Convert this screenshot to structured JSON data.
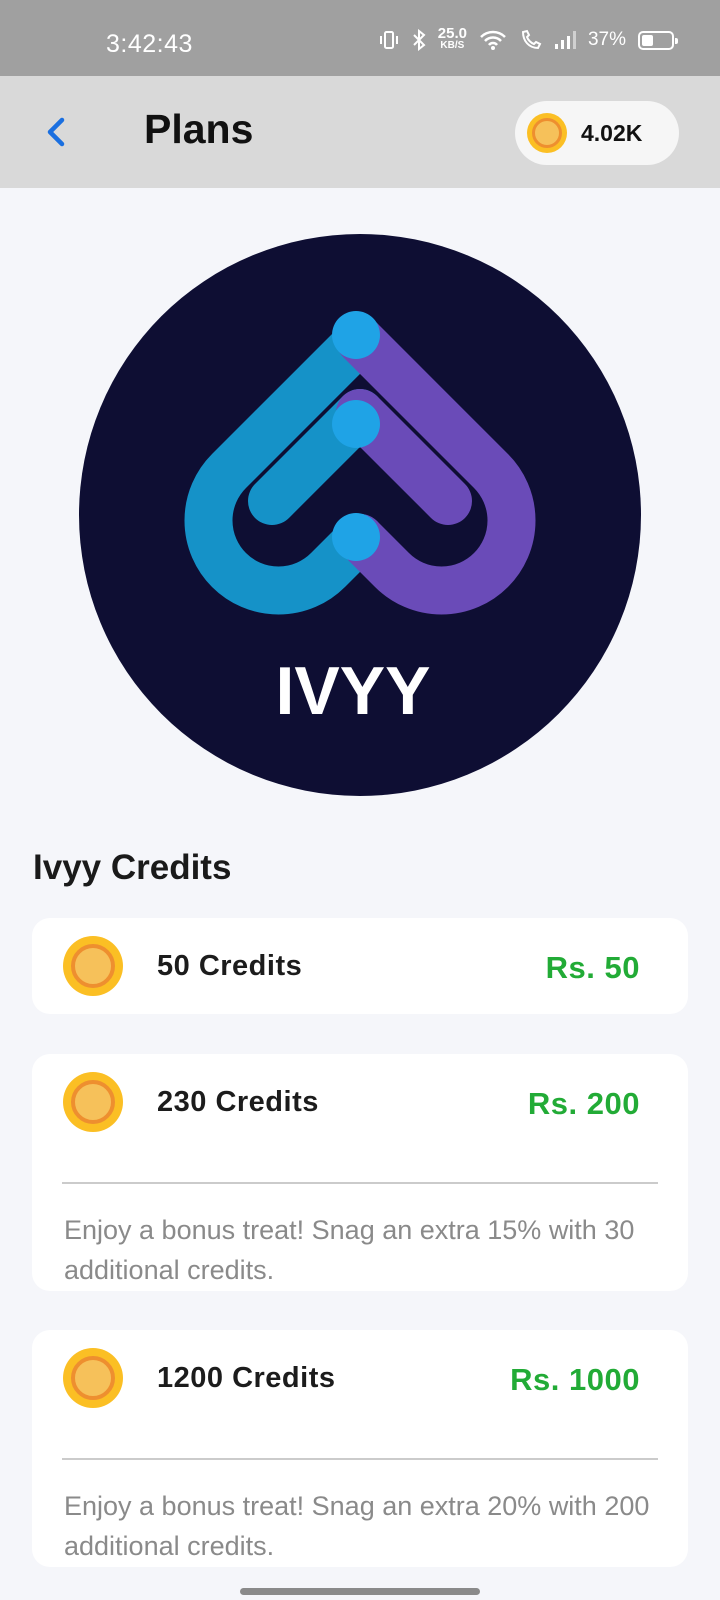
{
  "status_bar": {
    "time": "3:42:43",
    "net_speed_value": "25.0",
    "net_speed_unit": "KB/S",
    "battery": "37%"
  },
  "header": {
    "title": "Plans",
    "coin_balance": "4.02K"
  },
  "logo": {
    "text": "IVYY",
    "bg_color": "#0e0e33",
    "blue": "#1592c8",
    "purple": "#6a4bb8"
  },
  "section_title": "Ivyy Credits",
  "colors": {
    "price_green": "#22ab36",
    "coin_gold": "#fbbf24"
  },
  "plans": [
    {
      "name": "50 Credits",
      "price": "Rs. 50"
    },
    {
      "name": "230 Credits",
      "price": "Rs. 200",
      "description": "Enjoy a bonus treat! Snag an extra 15% with 30 additional credits."
    },
    {
      "name": "1200 Credits",
      "price": "Rs. 1000",
      "description": "Enjoy a bonus treat! Snag an extra 20% with 200 additional credits."
    }
  ]
}
